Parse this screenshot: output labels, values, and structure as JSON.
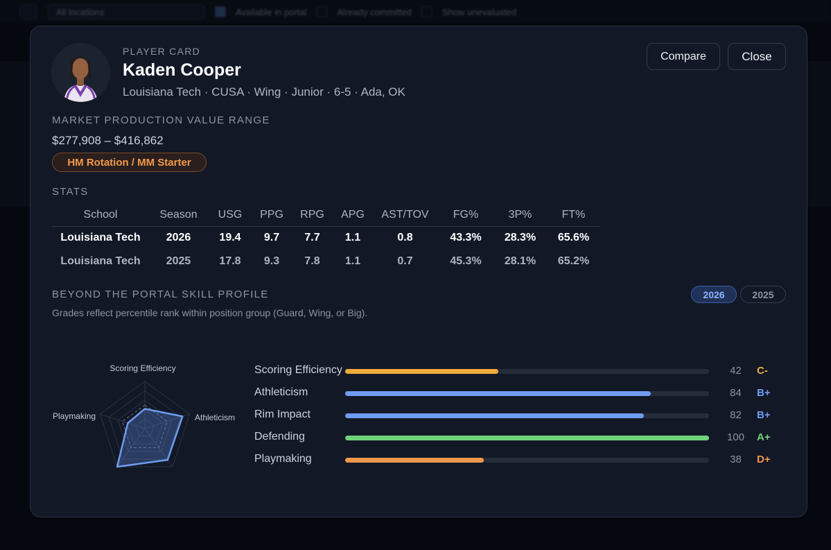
{
  "background": {
    "filter_text": "All locations",
    "checkbox_1": "Available in portal",
    "checkbox_2": "Already committed",
    "checkbox_3": "Show unevaluated"
  },
  "modal": {
    "kicker": "PLAYER CARD",
    "name": "Kaden Cooper",
    "meta": "Louisiana Tech · CUSA · Wing · Junior · 6-5 · Ada, OK",
    "compare_label": "Compare",
    "close_label": "Close"
  },
  "market": {
    "heading": "MARKET PRODUCTION VALUE RANGE",
    "range": "$277,908 – $416,862",
    "tier": "HM Rotation / MM Starter"
  },
  "stats": {
    "heading": "STATS",
    "columns": [
      "School",
      "Season",
      "USG",
      "PPG",
      "RPG",
      "APG",
      "AST/TOV",
      "FG%",
      "3P%",
      "FT%"
    ],
    "rows": [
      [
        "Louisiana Tech",
        "2026",
        "19.4",
        "9.7",
        "7.7",
        "1.1",
        "0.8",
        "43.3%",
        "28.3%",
        "65.6%"
      ],
      [
        "Louisiana Tech",
        "2025",
        "17.8",
        "9.3",
        "7.8",
        "1.1",
        "0.7",
        "45.3%",
        "28.1%",
        "65.2%"
      ]
    ]
  },
  "skill_profile": {
    "heading": "BEYOND THE PORTAL SKILL PROFILE",
    "note": "Grades reflect percentile rank within position group (Guard, Wing, or Big).",
    "years": [
      "2026",
      "2025"
    ],
    "selected_year": "2026",
    "skills": [
      {
        "label": "Scoring Efficiency",
        "value": 42,
        "grade": "C-",
        "color": "#f0ab3c"
      },
      {
        "label": "Athleticism",
        "value": 84,
        "grade": "B+",
        "color": "#6f9cf0"
      },
      {
        "label": "Rim Impact",
        "value": 82,
        "grade": "B+",
        "color": "#6f9cf0"
      },
      {
        "label": "Defending",
        "value": 100,
        "grade": "A+",
        "color": "#6fd37a"
      },
      {
        "label": "Playmaking",
        "value": 38,
        "grade": "D+",
        "color": "#f0974a"
      }
    ],
    "radar_labels": [
      "Scoring Efficiency",
      "Athleticism",
      "Rim Impact",
      "Defending",
      "Playmaking"
    ]
  }
}
